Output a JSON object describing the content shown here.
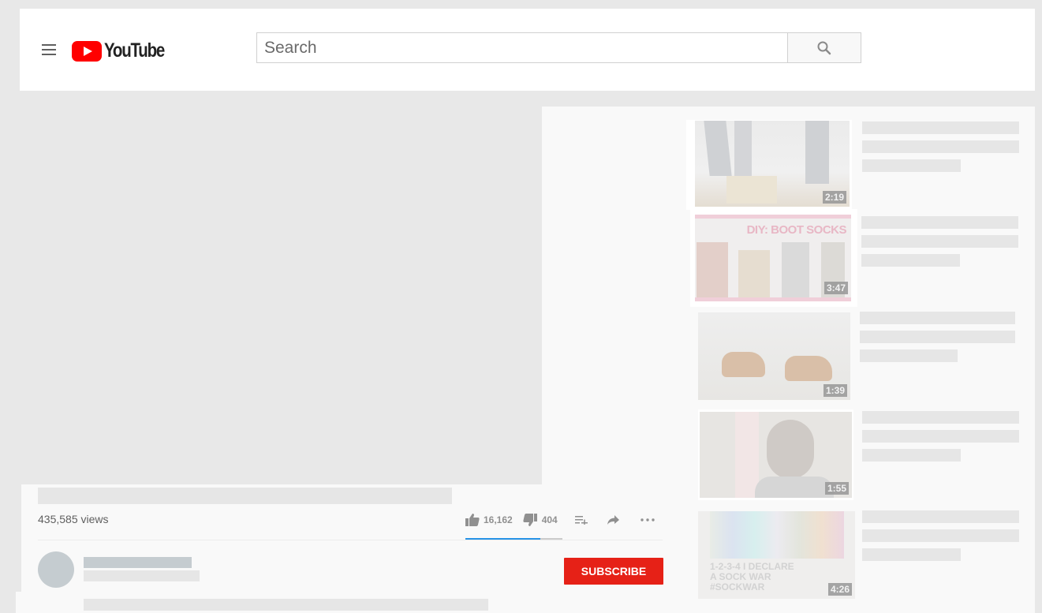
{
  "app": {
    "name": "YouTube"
  },
  "header": {
    "menu_icon": "hamburger-menu-icon",
    "logo_text": "YouTube",
    "search": {
      "placeholder": "Search",
      "value": ""
    },
    "search_button_icon": "search-icon"
  },
  "video": {
    "views": "435,585 views",
    "likes": "16,162",
    "dislikes": "404",
    "like_ratio": 0.77,
    "actions": [
      {
        "name": "like",
        "icon": "thumbs-up-icon"
      },
      {
        "name": "dislike",
        "icon": "thumbs-down-icon"
      },
      {
        "name": "add-to-playlist",
        "icon": "playlist-add-icon"
      },
      {
        "name": "share",
        "icon": "share-icon"
      },
      {
        "name": "more",
        "icon": "more-horizontal-icon"
      }
    ],
    "subscribe_label": "SUBSCRIBE"
  },
  "colors": {
    "brand_red": "#ff0000",
    "subscribe_red": "#e62117",
    "like_bar_blue": "#2793e6"
  },
  "related": [
    {
      "duration": "2:19",
      "thumb_text": ""
    },
    {
      "duration": "3:47",
      "thumb_text": "DIY: BOOT SOCKS"
    },
    {
      "duration": "1:39",
      "thumb_text": ""
    },
    {
      "duration": "1:55",
      "thumb_text": ""
    },
    {
      "duration": "4:26",
      "thumb_text": "1-2-3-4 I DECLARE A SOCK WAR #SOCKWAR"
    }
  ]
}
